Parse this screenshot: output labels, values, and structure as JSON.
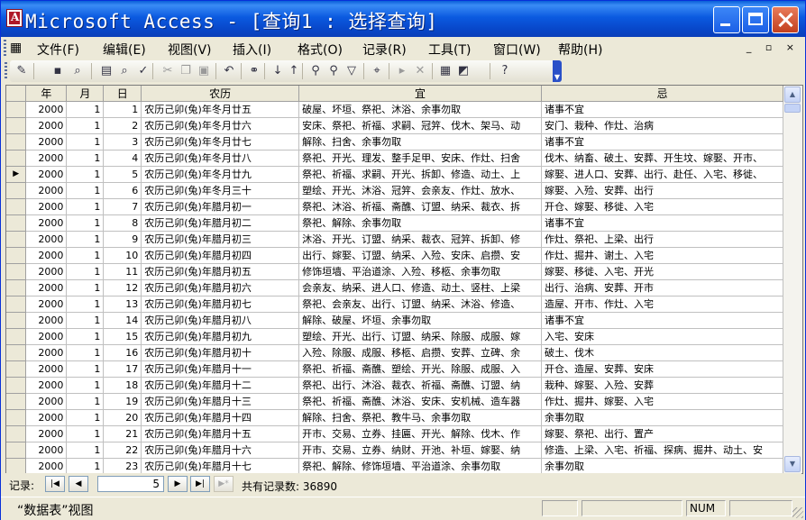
{
  "window": {
    "title": "Microsoft Access - [查询1 : 选择查询]"
  },
  "menu": [
    "文件(F)",
    "编辑(E)",
    "视图(V)",
    "插入(I)",
    "格式(O)",
    "记录(R)",
    "工具(T)",
    "窗口(W)",
    "帮助(H)"
  ],
  "mdi_controls": "_ ▫ ×",
  "toolbar_icons": [
    {
      "name": "design-view-icon",
      "glyph": "✎"
    },
    {
      "name": "save-icon",
      "glyph": "▪"
    },
    {
      "name": "search-icon",
      "glyph": "⌕"
    },
    {
      "name": "print-icon",
      "glyph": "▤"
    },
    {
      "name": "print-preview-icon",
      "glyph": "⌕"
    },
    {
      "name": "spelling-icon",
      "glyph": "✓"
    },
    {
      "name": "cut-icon",
      "glyph": "✂"
    },
    {
      "name": "copy-icon",
      "glyph": "❐"
    },
    {
      "name": "paste-icon",
      "glyph": "▣"
    },
    {
      "name": "undo-icon",
      "glyph": "↶"
    },
    {
      "name": "hyperlink-icon",
      "glyph": "⚭"
    },
    {
      "name": "sort-ascending-icon",
      "glyph": "↓"
    },
    {
      "name": "sort-descending-icon",
      "glyph": "↑"
    },
    {
      "name": "filter-by-selection-icon",
      "glyph": "⚲"
    },
    {
      "name": "filter-by-form-icon",
      "glyph": "⚲"
    },
    {
      "name": "apply-filter-icon",
      "glyph": "▽"
    },
    {
      "name": "find-icon",
      "glyph": "⌖"
    },
    {
      "name": "new-record-icon",
      "glyph": "▸"
    },
    {
      "name": "delete-record-icon",
      "glyph": "✕"
    },
    {
      "name": "database-window-icon",
      "glyph": "▦"
    },
    {
      "name": "new-object-icon",
      "glyph": "◩"
    },
    {
      "name": "help-icon",
      "glyph": "?"
    }
  ],
  "columns": [
    "年",
    "月",
    "日",
    "农历",
    "宜",
    "忌"
  ],
  "rows": [
    {
      "y": "2000",
      "m": "1",
      "d": "1",
      "nongli": "农历己卯(兔)年冬月廿五",
      "yi": "破屋、坏垣、祭祀、沐浴、余事勿取",
      "ji": "诸事不宜"
    },
    {
      "y": "2000",
      "m": "1",
      "d": "2",
      "nongli": "农历己卯(兔)年冬月廿六",
      "yi": "安床、祭祀、祈福、求嗣、冠笄、伐木、架马、动",
      "ji": "安门、栽种、作灶、治病"
    },
    {
      "y": "2000",
      "m": "1",
      "d": "3",
      "nongli": "农历己卯(兔)年冬月廿七",
      "yi": "解除、扫舍、余事勿取",
      "ji": "诸事不宜"
    },
    {
      "y": "2000",
      "m": "1",
      "d": "4",
      "nongli": "农历己卯(兔)年冬月廿八",
      "yi": "祭祀、开光、理发、整手足甲、安床、作灶、扫舍",
      "ji": "伐木、纳畜、破土、安葬、开生坟、嫁娶、开市、"
    },
    {
      "y": "2000",
      "m": "1",
      "d": "5",
      "nongli": "农历己卯(兔)年冬月廿九",
      "yi": "祭祀、祈福、求嗣、开光、拆卸、修造、动土、上",
      "ji": "嫁娶、进人口、安葬、出行、赴任、入宅、移徙、"
    },
    {
      "y": "2000",
      "m": "1",
      "d": "6",
      "nongli": "农历己卯(兔)年冬月三十",
      "yi": "塑绘、开光、沐浴、冠笄、会亲友、作灶、放水、",
      "ji": "嫁娶、入殓、安葬、出行"
    },
    {
      "y": "2000",
      "m": "1",
      "d": "7",
      "nongli": "农历己卯(兔)年腊月初一",
      "yi": "祭祀、沐浴、祈福、斋醮、订盟、纳采、裁衣、拆",
      "ji": "开仓、嫁娶、移徙、入宅"
    },
    {
      "y": "2000",
      "m": "1",
      "d": "8",
      "nongli": "农历己卯(兔)年腊月初二",
      "yi": "祭祀、解除、余事勿取",
      "ji": "诸事不宜"
    },
    {
      "y": "2000",
      "m": "1",
      "d": "9",
      "nongli": "农历己卯(兔)年腊月初三",
      "yi": "沐浴、开光、订盟、纳采、裁衣、冠笄、拆卸、修",
      "ji": "作灶、祭祀、上梁、出行"
    },
    {
      "y": "2000",
      "m": "1",
      "d": "10",
      "nongli": "农历己卯(兔)年腊月初四",
      "yi": "出行、嫁娶、订盟、纳采、入殓、安床、启攒、安",
      "ji": "作灶、掘井、谢土、入宅"
    },
    {
      "y": "2000",
      "m": "1",
      "d": "11",
      "nongli": "农历己卯(兔)年腊月初五",
      "yi": "修饰垣墙、平治道涂、入殓、移柩、余事勿取",
      "ji": "嫁娶、移徙、入宅、开光"
    },
    {
      "y": "2000",
      "m": "1",
      "d": "12",
      "nongli": "农历己卯(兔)年腊月初六",
      "yi": "会亲友、纳采、进人口、修造、动土、竖柱、上梁",
      "ji": "出行、治病、安葬、开市"
    },
    {
      "y": "2000",
      "m": "1",
      "d": "13",
      "nongli": "农历己卯(兔)年腊月初七",
      "yi": "祭祀、会亲友、出行、订盟、纳采、沐浴、修造、",
      "ji": "造屋、开市、作灶、入宅"
    },
    {
      "y": "2000",
      "m": "1",
      "d": "14",
      "nongli": "农历己卯(兔)年腊月初八",
      "yi": "解除、破屋、坏垣、余事勿取",
      "ji": "诸事不宜"
    },
    {
      "y": "2000",
      "m": "1",
      "d": "15",
      "nongli": "农历己卯(兔)年腊月初九",
      "yi": "塑绘、开光、出行、订盟、纳采、除服、成服、嫁",
      "ji": "入宅、安床"
    },
    {
      "y": "2000",
      "m": "1",
      "d": "16",
      "nongli": "农历己卯(兔)年腊月初十",
      "yi": "入殓、除服、成服、移柩、启攒、安葬、立碑、余",
      "ji": "破土、伐木"
    },
    {
      "y": "2000",
      "m": "1",
      "d": "17",
      "nongli": "农历己卯(兔)年腊月十一",
      "yi": "祭祀、祈福、斋醮、塑绘、开光、除服、成服、入",
      "ji": "开仓、造屋、安葬、安床"
    },
    {
      "y": "2000",
      "m": "1",
      "d": "18",
      "nongli": "农历己卯(兔)年腊月十二",
      "yi": "祭祀、出行、沐浴、裁衣、祈福、斋醮、订盟、纳",
      "ji": "栽种、嫁娶、入殓、安葬"
    },
    {
      "y": "2000",
      "m": "1",
      "d": "19",
      "nongli": "农历己卯(兔)年腊月十三",
      "yi": "祭祀、祈福、斋醮、沐浴、安床、安机械、造车器",
      "ji": "作灶、掘井、嫁娶、入宅"
    },
    {
      "y": "2000",
      "m": "1",
      "d": "20",
      "nongli": "农历己卯(兔)年腊月十四",
      "yi": "解除、扫舍、祭祀、教牛马、余事勿取",
      "ji": "余事勿取"
    },
    {
      "y": "2000",
      "m": "1",
      "d": "21",
      "nongli": "农历己卯(兔)年腊月十五",
      "yi": "开市、交易、立券、挂匾、开光、解除、伐木、作",
      "ji": "嫁娶、祭祀、出行、置产"
    },
    {
      "y": "2000",
      "m": "1",
      "d": "22",
      "nongli": "农历己卯(兔)年腊月十六",
      "yi": "开市、交易、立券、纳财、开池、补垣、嫁娶、纳",
      "ji": "修造、上梁、入宅、祈福、探病、掘井、动土、安"
    },
    {
      "y": "2000",
      "m": "1",
      "d": "23",
      "nongli": "农历己卯(兔)年腊月十七",
      "yi": "祭祀、解除、修饰垣墙、平治道涂、余事勿取",
      "ji": "余事勿取"
    }
  ],
  "current_row_index": 4,
  "record_nav": {
    "label": "记录:",
    "current": "5",
    "total_text": "共有记录数: 36890"
  },
  "status": {
    "text": "“数据表”视图",
    "num": "NUM"
  }
}
